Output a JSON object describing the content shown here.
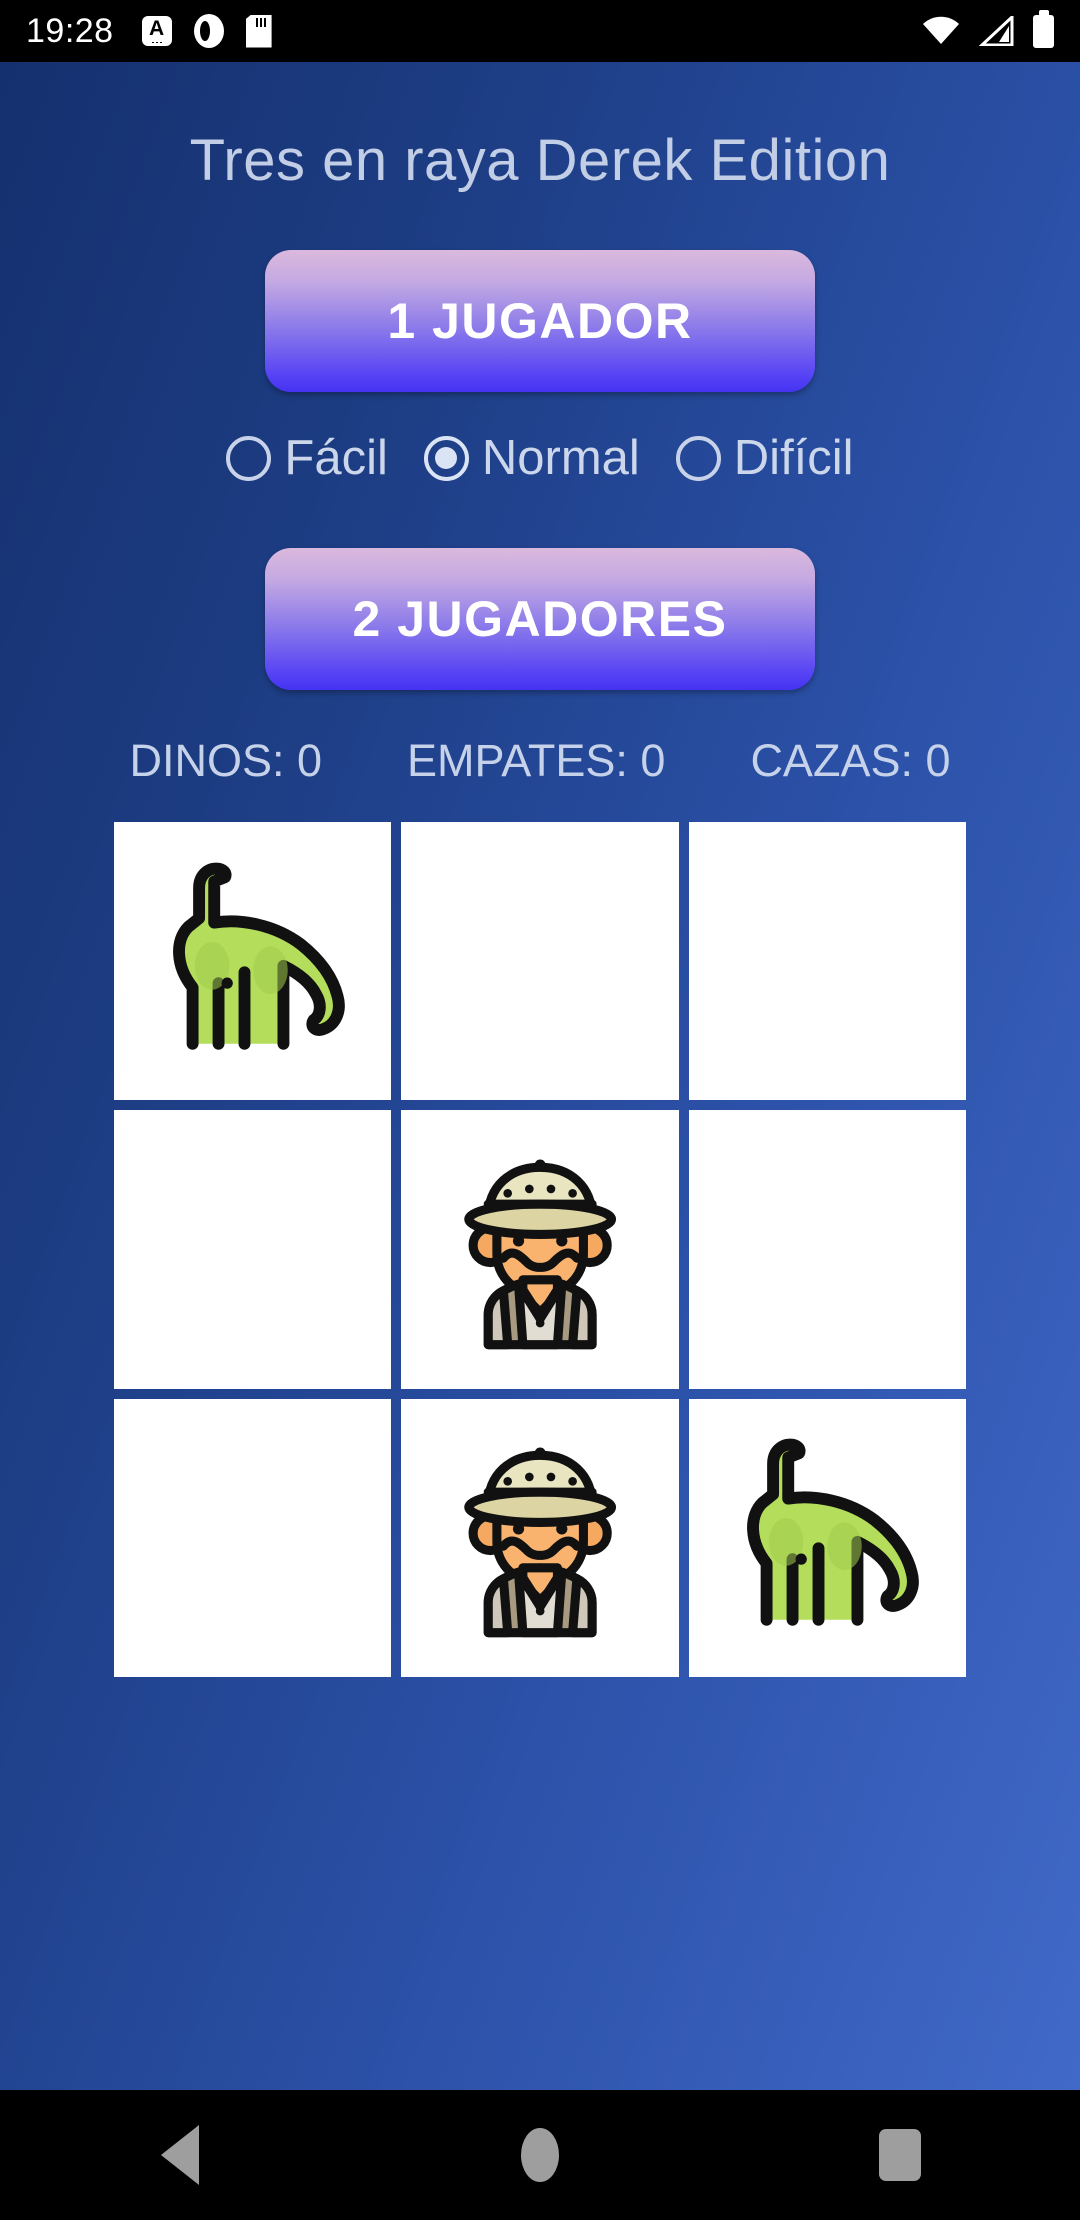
{
  "status_bar": {
    "time": "19:28",
    "left_icons": [
      "font-size-a-icon",
      "alarm-clock-icon",
      "sd-card-icon"
    ],
    "right_icons": [
      "wifi-icon",
      "cellular-signal-icon",
      "battery-icon"
    ]
  },
  "app": {
    "title": "Tres en raya Derek Edition",
    "one_player_button": "1 JUGADOR",
    "two_players_button": "2 JUGADORES",
    "difficulty": {
      "options": [
        {
          "label": "Fácil",
          "selected": false
        },
        {
          "label": "Normal",
          "selected": true
        },
        {
          "label": "Difícil",
          "selected": false
        }
      ]
    },
    "stats": [
      {
        "label": "DINOS:",
        "value": "0",
        "text": "DINOS: 0"
      },
      {
        "label": "EMPATES:",
        "value": "0",
        "text": "EMPATES: 0"
      },
      {
        "label": "CAZAS:",
        "value": "0",
        "text": "CAZAS: 0"
      }
    ],
    "board": {
      "cells": [
        {
          "index": 0,
          "mark": "dino"
        },
        {
          "index": 1,
          "mark": ""
        },
        {
          "index": 2,
          "mark": ""
        },
        {
          "index": 3,
          "mark": ""
        },
        {
          "index": 4,
          "mark": "hunter"
        },
        {
          "index": 5,
          "mark": ""
        },
        {
          "index": 6,
          "mark": ""
        },
        {
          "index": 7,
          "mark": "hunter"
        },
        {
          "index": 8,
          "mark": "dino"
        }
      ]
    }
  },
  "nav_bar": {
    "back": "back-nav-button",
    "home": "home-nav-button",
    "recents": "recents-nav-button"
  },
  "colors": {
    "background_dark": "#15306e",
    "background_light": "#4169c8",
    "button_top": "#dbb9dd",
    "button_bottom": "#4533f2",
    "text_light": "#c6d2e9",
    "cell_bg": "#ffffff",
    "dino_green": "#b3dd5b",
    "hunter_skin": "#f5a860"
  }
}
